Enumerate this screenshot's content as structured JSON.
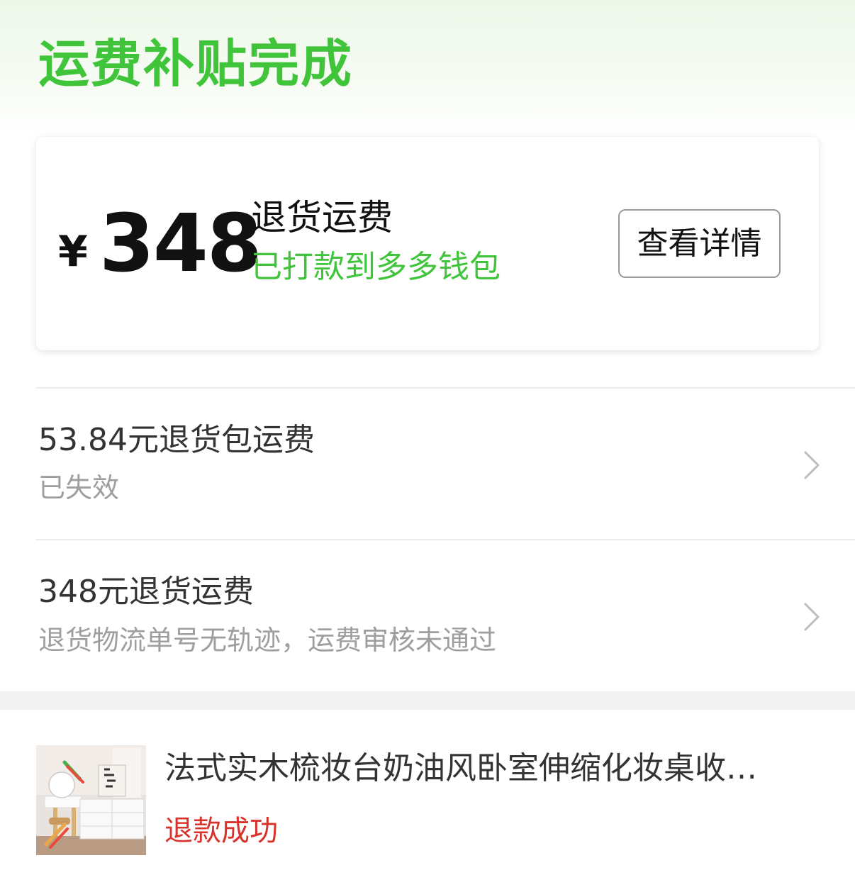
{
  "header": {
    "title": "运费补贴完成"
  },
  "summary_card": {
    "currency_symbol": "¥",
    "amount": "348",
    "label": "退货运费",
    "status": "已打款到多多钱包",
    "detail_button_label": "查看详情"
  },
  "records": [
    {
      "title": "53.84元退货包运费",
      "subtitle": "已失效"
    },
    {
      "title": "348元退货运费",
      "subtitle": "退货物流单号无轨迹，运费审核未通过"
    }
  ],
  "product": {
    "name": "法式实木梳妆台奶油风卧室伸缩化妆桌收…",
    "status": "退款成功"
  },
  "colors": {
    "accent_green": "#3fc43a",
    "status_red": "#d9322b",
    "secondary_text": "#9e9e9e"
  }
}
